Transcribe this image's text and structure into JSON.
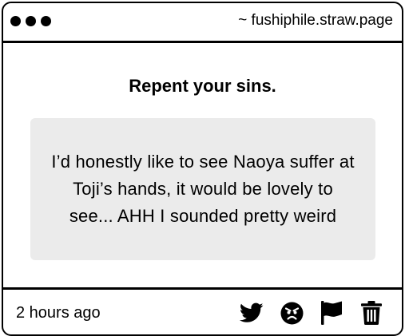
{
  "window": {
    "url": "~ fushiphile.straw.page"
  },
  "post": {
    "heading": "Repent your sins.",
    "message": "I’d honestly like to see Naoya suffer at Toji’s hands, it would be lovely to see... AHH I sounded pretty weird"
  },
  "footer": {
    "timestamp": "2 hours ago",
    "actions": [
      {
        "name": "twitter-share",
        "icon": "twitter-icon"
      },
      {
        "name": "angry-react",
        "icon": "angry-face-icon"
      },
      {
        "name": "report",
        "icon": "flag-icon"
      },
      {
        "name": "delete",
        "icon": "trash-icon"
      }
    ]
  }
}
